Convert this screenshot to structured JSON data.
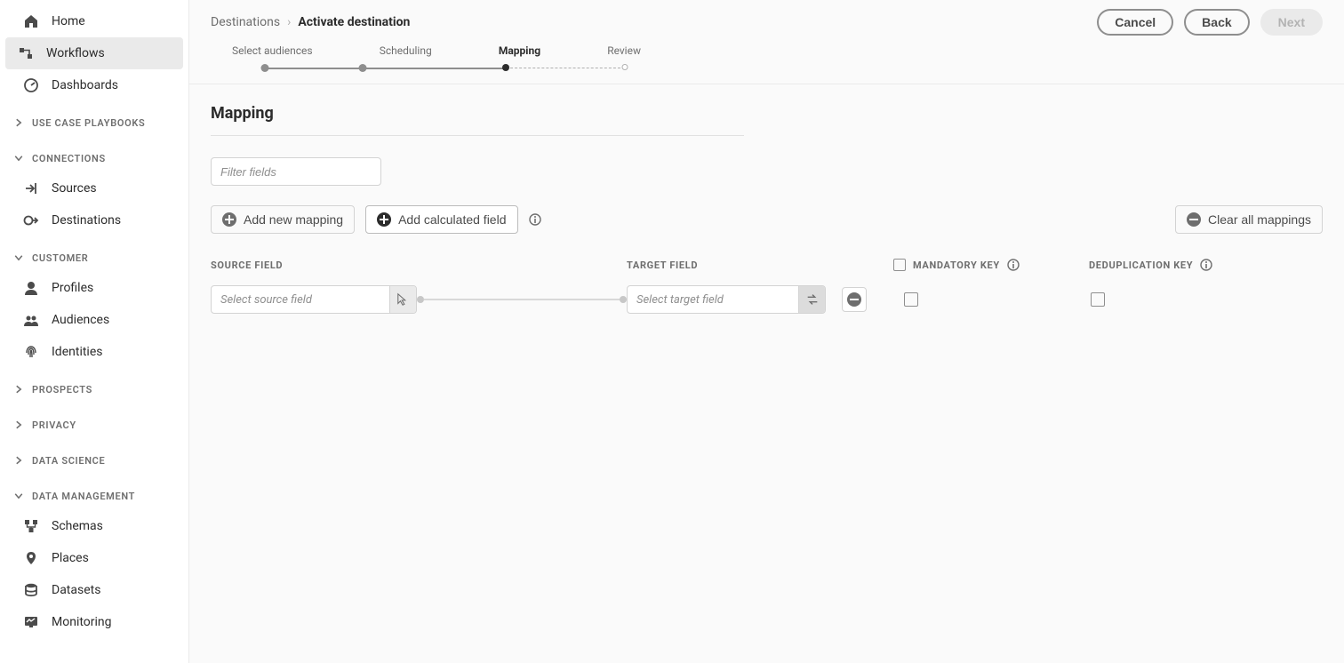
{
  "sidebar": {
    "items_top": [
      {
        "icon": "home",
        "label": "Home"
      },
      {
        "icon": "workflow",
        "label": "Workflows",
        "selected": true
      },
      {
        "icon": "dashboard",
        "label": "Dashboards"
      }
    ],
    "sections": [
      {
        "label": "USE CASE PLAYBOOKS",
        "expanded": false,
        "items": []
      },
      {
        "label": "CONNECTIONS",
        "expanded": true,
        "items": [
          {
            "icon": "in-arrow",
            "label": "Sources"
          },
          {
            "icon": "out-arrow",
            "label": "Destinations"
          }
        ]
      },
      {
        "label": "CUSTOMER",
        "expanded": true,
        "items": [
          {
            "icon": "profile",
            "label": "Profiles"
          },
          {
            "icon": "audiences",
            "label": "Audiences"
          },
          {
            "icon": "fingerprint",
            "label": "Identities"
          }
        ]
      },
      {
        "label": "PROSPECTS",
        "expanded": false,
        "items": []
      },
      {
        "label": "PRIVACY",
        "expanded": false,
        "items": []
      },
      {
        "label": "DATA SCIENCE",
        "expanded": false,
        "items": []
      },
      {
        "label": "DATA MANAGEMENT",
        "expanded": true,
        "items": [
          {
            "icon": "schemas",
            "label": "Schemas"
          },
          {
            "icon": "places",
            "label": "Places"
          },
          {
            "icon": "datasets",
            "label": "Datasets"
          },
          {
            "icon": "monitoring",
            "label": "Monitoring"
          }
        ]
      }
    ]
  },
  "breadcrumb": {
    "parent": "Destinations",
    "current": "Activate destination"
  },
  "header_actions": {
    "cancel": "Cancel",
    "back": "Back",
    "next": "Next"
  },
  "stepper": {
    "steps": [
      "Select audiences",
      "Scheduling",
      "Mapping",
      "Review"
    ],
    "active_index": 2
  },
  "page": {
    "title": "Mapping",
    "filter_placeholder": "Filter fields",
    "add_mapping": "Add new mapping",
    "add_calculated": "Add calculated field",
    "clear_all": "Clear all mappings",
    "columns": {
      "source": "Source Field",
      "target": "Target Field",
      "mandatory": "Mandatory Key",
      "dedup": "Deduplication Key"
    },
    "row": {
      "source_ph": "Select source field",
      "target_ph": "Select target field"
    }
  }
}
